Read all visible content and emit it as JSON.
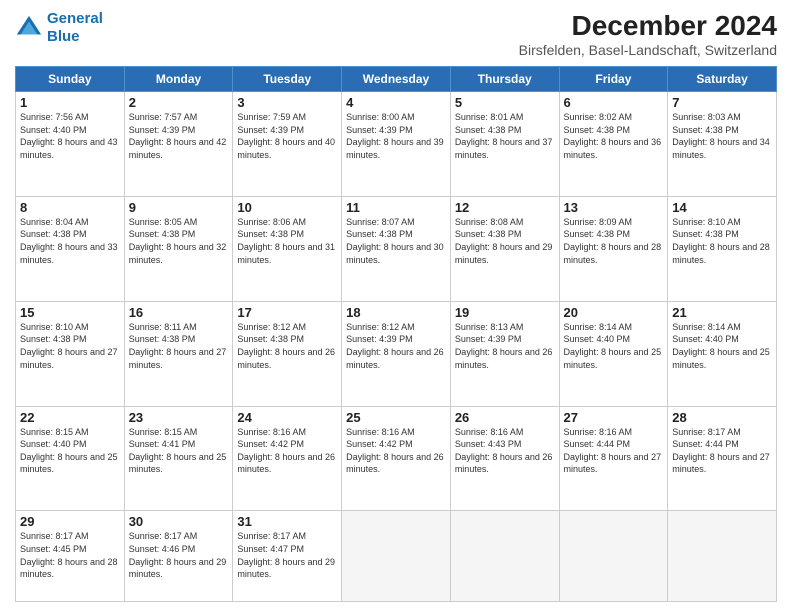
{
  "header": {
    "logo_line1": "General",
    "logo_line2": "Blue",
    "title": "December 2024",
    "subtitle": "Birsfelden, Basel-Landschaft, Switzerland"
  },
  "columns": [
    "Sunday",
    "Monday",
    "Tuesday",
    "Wednesday",
    "Thursday",
    "Friday",
    "Saturday"
  ],
  "weeks": [
    [
      {
        "day": "1",
        "sunrise": "Sunrise: 7:56 AM",
        "sunset": "Sunset: 4:40 PM",
        "daylight": "Daylight: 8 hours and 43 minutes."
      },
      {
        "day": "2",
        "sunrise": "Sunrise: 7:57 AM",
        "sunset": "Sunset: 4:39 PM",
        "daylight": "Daylight: 8 hours and 42 minutes."
      },
      {
        "day": "3",
        "sunrise": "Sunrise: 7:59 AM",
        "sunset": "Sunset: 4:39 PM",
        "daylight": "Daylight: 8 hours and 40 minutes."
      },
      {
        "day": "4",
        "sunrise": "Sunrise: 8:00 AM",
        "sunset": "Sunset: 4:39 PM",
        "daylight": "Daylight: 8 hours and 39 minutes."
      },
      {
        "day": "5",
        "sunrise": "Sunrise: 8:01 AM",
        "sunset": "Sunset: 4:38 PM",
        "daylight": "Daylight: 8 hours and 37 minutes."
      },
      {
        "day": "6",
        "sunrise": "Sunrise: 8:02 AM",
        "sunset": "Sunset: 4:38 PM",
        "daylight": "Daylight: 8 hours and 36 minutes."
      },
      {
        "day": "7",
        "sunrise": "Sunrise: 8:03 AM",
        "sunset": "Sunset: 4:38 PM",
        "daylight": "Daylight: 8 hours and 34 minutes."
      }
    ],
    [
      {
        "day": "8",
        "sunrise": "Sunrise: 8:04 AM",
        "sunset": "Sunset: 4:38 PM",
        "daylight": "Daylight: 8 hours and 33 minutes."
      },
      {
        "day": "9",
        "sunrise": "Sunrise: 8:05 AM",
        "sunset": "Sunset: 4:38 PM",
        "daylight": "Daylight: 8 hours and 32 minutes."
      },
      {
        "day": "10",
        "sunrise": "Sunrise: 8:06 AM",
        "sunset": "Sunset: 4:38 PM",
        "daylight": "Daylight: 8 hours and 31 minutes."
      },
      {
        "day": "11",
        "sunrise": "Sunrise: 8:07 AM",
        "sunset": "Sunset: 4:38 PM",
        "daylight": "Daylight: 8 hours and 30 minutes."
      },
      {
        "day": "12",
        "sunrise": "Sunrise: 8:08 AM",
        "sunset": "Sunset: 4:38 PM",
        "daylight": "Daylight: 8 hours and 29 minutes."
      },
      {
        "day": "13",
        "sunrise": "Sunrise: 8:09 AM",
        "sunset": "Sunset: 4:38 PM",
        "daylight": "Daylight: 8 hours and 28 minutes."
      },
      {
        "day": "14",
        "sunrise": "Sunrise: 8:10 AM",
        "sunset": "Sunset: 4:38 PM",
        "daylight": "Daylight: 8 hours and 28 minutes."
      }
    ],
    [
      {
        "day": "15",
        "sunrise": "Sunrise: 8:10 AM",
        "sunset": "Sunset: 4:38 PM",
        "daylight": "Daylight: 8 hours and 27 minutes."
      },
      {
        "day": "16",
        "sunrise": "Sunrise: 8:11 AM",
        "sunset": "Sunset: 4:38 PM",
        "daylight": "Daylight: 8 hours and 27 minutes."
      },
      {
        "day": "17",
        "sunrise": "Sunrise: 8:12 AM",
        "sunset": "Sunset: 4:38 PM",
        "daylight": "Daylight: 8 hours and 26 minutes."
      },
      {
        "day": "18",
        "sunrise": "Sunrise: 8:12 AM",
        "sunset": "Sunset: 4:39 PM",
        "daylight": "Daylight: 8 hours and 26 minutes."
      },
      {
        "day": "19",
        "sunrise": "Sunrise: 8:13 AM",
        "sunset": "Sunset: 4:39 PM",
        "daylight": "Daylight: 8 hours and 26 minutes."
      },
      {
        "day": "20",
        "sunrise": "Sunrise: 8:14 AM",
        "sunset": "Sunset: 4:40 PM",
        "daylight": "Daylight: 8 hours and 25 minutes."
      },
      {
        "day": "21",
        "sunrise": "Sunrise: 8:14 AM",
        "sunset": "Sunset: 4:40 PM",
        "daylight": "Daylight: 8 hours and 25 minutes."
      }
    ],
    [
      {
        "day": "22",
        "sunrise": "Sunrise: 8:15 AM",
        "sunset": "Sunset: 4:40 PM",
        "daylight": "Daylight: 8 hours and 25 minutes."
      },
      {
        "day": "23",
        "sunrise": "Sunrise: 8:15 AM",
        "sunset": "Sunset: 4:41 PM",
        "daylight": "Daylight: 8 hours and 25 minutes."
      },
      {
        "day": "24",
        "sunrise": "Sunrise: 8:16 AM",
        "sunset": "Sunset: 4:42 PM",
        "daylight": "Daylight: 8 hours and 26 minutes."
      },
      {
        "day": "25",
        "sunrise": "Sunrise: 8:16 AM",
        "sunset": "Sunset: 4:42 PM",
        "daylight": "Daylight: 8 hours and 26 minutes."
      },
      {
        "day": "26",
        "sunrise": "Sunrise: 8:16 AM",
        "sunset": "Sunset: 4:43 PM",
        "daylight": "Daylight: 8 hours and 26 minutes."
      },
      {
        "day": "27",
        "sunrise": "Sunrise: 8:16 AM",
        "sunset": "Sunset: 4:44 PM",
        "daylight": "Daylight: 8 hours and 27 minutes."
      },
      {
        "day": "28",
        "sunrise": "Sunrise: 8:17 AM",
        "sunset": "Sunset: 4:44 PM",
        "daylight": "Daylight: 8 hours and 27 minutes."
      }
    ],
    [
      {
        "day": "29",
        "sunrise": "Sunrise: 8:17 AM",
        "sunset": "Sunset: 4:45 PM",
        "daylight": "Daylight: 8 hours and 28 minutes."
      },
      {
        "day": "30",
        "sunrise": "Sunrise: 8:17 AM",
        "sunset": "Sunset: 4:46 PM",
        "daylight": "Daylight: 8 hours and 29 minutes."
      },
      {
        "day": "31",
        "sunrise": "Sunrise: 8:17 AM",
        "sunset": "Sunset: 4:47 PM",
        "daylight": "Daylight: 8 hours and 29 minutes."
      },
      null,
      null,
      null,
      null
    ]
  ]
}
